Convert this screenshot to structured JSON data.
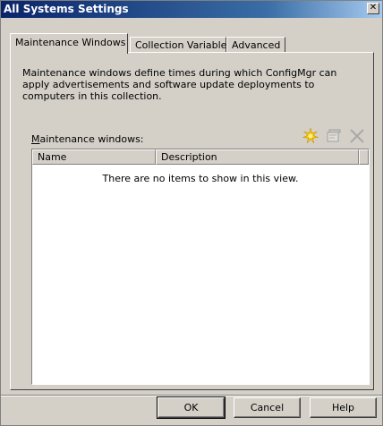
{
  "window": {
    "title": "All Systems Settings",
    "close_glyph": "✕"
  },
  "tabs": [
    {
      "label": "Maintenance Windows",
      "active": true
    },
    {
      "label": "Collection Variables",
      "active": false
    },
    {
      "label": "Advanced",
      "active": false
    }
  ],
  "panel": {
    "description": "Maintenance windows define times during which ConfigMgr can apply advertisements and software update deployments to computers in this collection.",
    "list_label_accel": "M",
    "list_label_rest": "aintenance windows:",
    "toolbar": [
      {
        "name": "new-icon",
        "enabled": true
      },
      {
        "name": "properties-icon",
        "enabled": false
      },
      {
        "name": "delete-icon",
        "enabled": false
      }
    ],
    "columns": [
      "Name",
      "Description"
    ],
    "empty_message": "There are no items to show in this view."
  },
  "buttons": {
    "ok": "OK",
    "cancel": "Cancel",
    "help": "Help"
  },
  "colors": {
    "titlebar_start": "#0a246a",
    "titlebar_end": "#a6caf0",
    "dialog_face": "#d4d0c8",
    "new_icon_accent": "#f5c400"
  }
}
